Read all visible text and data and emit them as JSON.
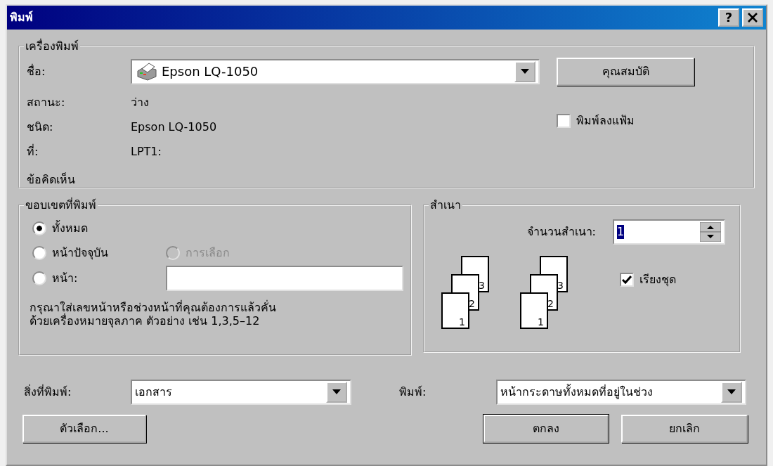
{
  "window": {
    "title": "พิมพ์",
    "help_button": "?"
  },
  "printer": {
    "legend": "เครื่องพิมพ์",
    "name_label": "ชื่อ:",
    "name_value": "Epson LQ-1050",
    "properties_button": "คุณสมบัติ",
    "rows": [
      {
        "label": "สถานะ:",
        "value": "ว่าง"
      },
      {
        "label": "ชนิด:",
        "value": "Epson LQ-1050"
      },
      {
        "label": "ที่:",
        "value": "LPT1:"
      },
      {
        "label": "ข้อคิดเห็น",
        "value": ""
      }
    ],
    "print_to_file": {
      "label": "พิมพ์ลงแฟ้ม",
      "checked": false
    }
  },
  "range": {
    "legend": "ขอบเขตที่พิมพ์",
    "options": [
      {
        "label": "ทั้งหมด",
        "selected": true,
        "disabled": false
      },
      {
        "label": "หน้าปัจจุบัน",
        "selected": false,
        "disabled": false
      },
      {
        "label": "การเลือก",
        "selected": false,
        "disabled": true
      },
      {
        "label": "หน้า:",
        "selected": false,
        "disabled": false
      }
    ],
    "hint_lines": [
      "กรุณาใส่เลขหน้าหรือช่วงหน้าที่คุณต้องการแล้วคั่น",
      "ด้วยเครื่องหมายจุลภาค  ตัวอย่าง เช่น 1,3,5–12"
    ]
  },
  "copies": {
    "legend": "สำเนา",
    "count_label": "จำนวนสำเนา:",
    "count_value": "1",
    "count_highlighted": true,
    "stacks": [
      {
        "pages": [
          "3",
          "2",
          "1"
        ]
      },
      {
        "pages": [
          "3",
          "2",
          "1"
        ]
      }
    ],
    "collate": {
      "label": "เรียงชุด",
      "checked": true
    }
  },
  "print_what": {
    "label": "สิ่งที่พิมพ์:",
    "value": "เอกสาร"
  },
  "print_scope": {
    "label": "พิมพ์:",
    "value": "หน้ากระดาษทั้งหมดที่อยู่ในช่วง"
  },
  "buttons": {
    "options": "ตัวเลือก...",
    "ok": "ตกลง",
    "cancel": "ยกเลิก"
  }
}
